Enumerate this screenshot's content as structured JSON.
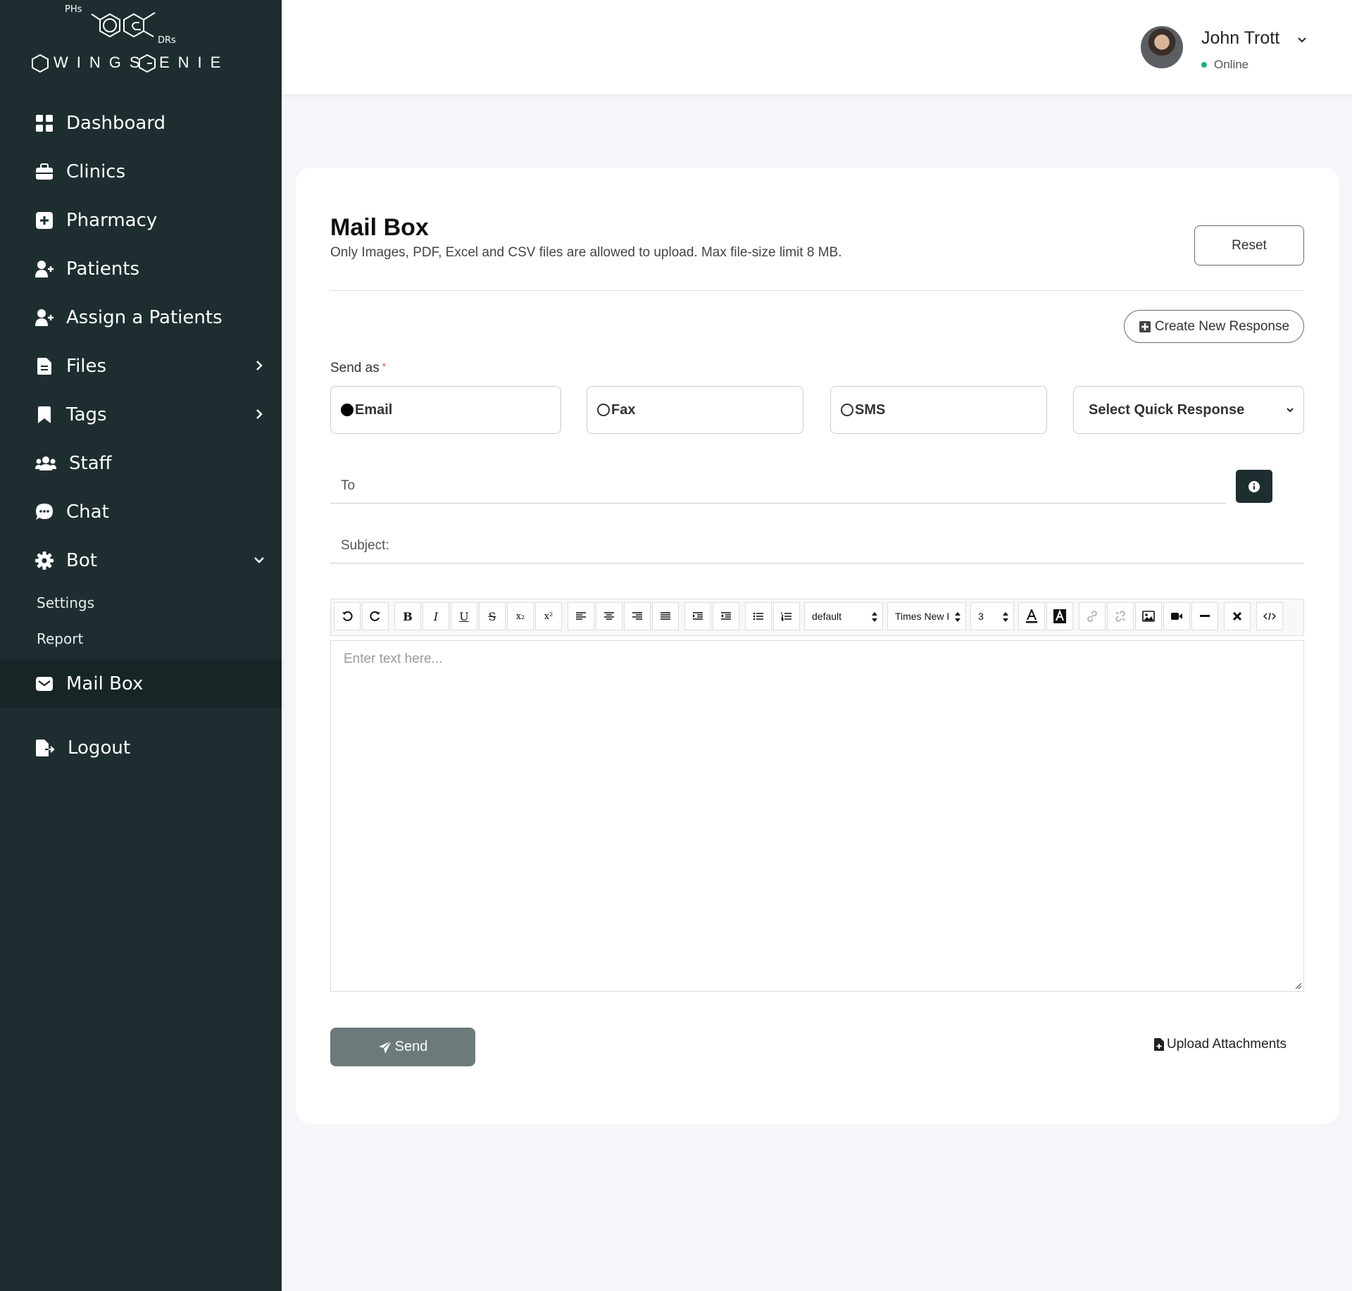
{
  "brand": {
    "top_text": "PHs",
    "side_text": "DRs",
    "left_word": "WINGS",
    "right_word": "ENIE"
  },
  "sidebar": {
    "items": [
      {
        "label": "Dashboard",
        "icon": "grid-icon"
      },
      {
        "label": "Clinics",
        "icon": "briefcase-icon"
      },
      {
        "label": "Pharmacy",
        "icon": "plus-square-icon"
      },
      {
        "label": "Patients",
        "icon": "user-plus-icon"
      },
      {
        "label": "Assign a Patients",
        "icon": "user-plus-icon"
      },
      {
        "label": "Files",
        "icon": "file-icon"
      },
      {
        "label": "Tags",
        "icon": "bookmark-icon"
      },
      {
        "label": "Staff",
        "icon": "users-icon"
      },
      {
        "label": "Chat",
        "icon": "chat-icon"
      },
      {
        "label": "Bot",
        "icon": "gear-icon"
      }
    ],
    "bot_sub": [
      {
        "label": "Settings"
      },
      {
        "label": "Report"
      }
    ],
    "mailbox": {
      "label": "Mail Box",
      "icon": "envelope-icon"
    },
    "logout": {
      "label": "Logout",
      "icon": "logout-icon"
    }
  },
  "header": {
    "user_name": "John Trott",
    "status": "Online",
    "status_color": "#1fb37a"
  },
  "main": {
    "title": "Mail Box",
    "subtitle": "Only Images, PDF, Excel and CSV files are allowed to upload. Max file-size limit 8 MB.",
    "reset_label": "Reset",
    "create_label": "Create New Response",
    "send_as_label": "Send as",
    "required_mark": "*",
    "options": {
      "email": "Email",
      "fax": "Fax",
      "sms": "SMS"
    },
    "selected_option": "Email",
    "quick_response": "Select Quick Response",
    "to_placeholder": "To",
    "subject_placeholder": "Subject:",
    "editor": {
      "font_format": "default",
      "font_family": "Times New R",
      "font_size": "3",
      "placeholder": "Enter text here..."
    },
    "send_label": "Send",
    "upload_label": "Upload Attachments"
  },
  "colors": {
    "sidebar_bg": "#1e2e30",
    "sidebar_active": "#172527",
    "send_button": "#6c7a7b",
    "accent_dark": "#1e2e30"
  }
}
